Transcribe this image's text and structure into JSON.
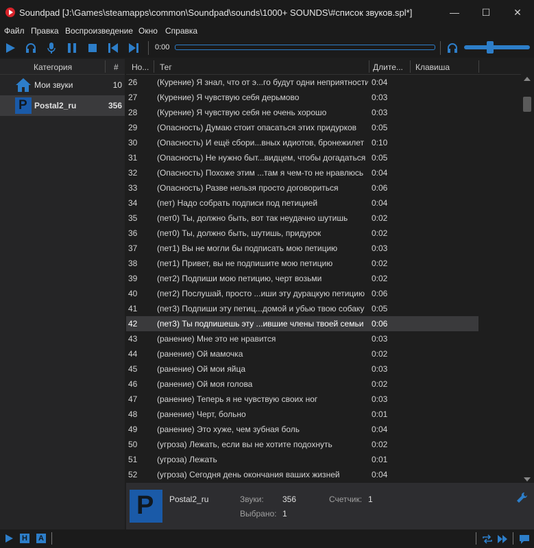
{
  "window": {
    "title": "Soundpad [J:\\Games\\steamapps\\common\\Soundpad\\sounds\\1000+ SOUNDS\\#список звуков.spl*]",
    "minimize": "—",
    "maximize": "☐",
    "close": "✕"
  },
  "menu": [
    "Файл",
    "Правка",
    "Воспроизведение",
    "Окно",
    "Справка"
  ],
  "toolbar": {
    "time": "0:00",
    "progress": 0,
    "volume": 0.4,
    "accent": "#2d7ec9"
  },
  "categories": {
    "header_name": "Категория",
    "header_count": "#",
    "items": [
      {
        "name": "Мои звуки",
        "count": "10",
        "icon": "home-icon"
      },
      {
        "name": "Postal2_ru",
        "count": "356",
        "icon": "postal-logo-icon",
        "selected": true
      }
    ]
  },
  "list": {
    "headers": {
      "num": "Но...",
      "tag": "Тег",
      "duration": "Длите...",
      "hotkey": "Клавиша"
    },
    "rows": [
      {
        "num": "26",
        "tag": "(Курение) Я знал, что от э...го будут одни неприятности",
        "dur": "0:04"
      },
      {
        "num": "27",
        "tag": "(Курение) Я чувствую себя дерьмово",
        "dur": "0:03"
      },
      {
        "num": "28",
        "tag": "(Курение) Я чувствую себя не очень хорошо",
        "dur": "0:03"
      },
      {
        "num": "29",
        "tag": "(Опасность) Думаю стоит опасаться этих придурков",
        "dur": "0:05"
      },
      {
        "num": "30",
        "tag": "(Опасность) И ещё сбори...вных идиотов, бронежилет",
        "dur": "0:10"
      },
      {
        "num": "31",
        "tag": "(Опасность) Не нужно быт...видцем, чтобы догадаться",
        "dur": "0:05"
      },
      {
        "num": "32",
        "tag": "(Опасность) Похоже этим ...там я чем-то не нравлюсь",
        "dur": "0:04"
      },
      {
        "num": "33",
        "tag": "(Опасность) Разве нельзя просто договориться",
        "dur": "0:06"
      },
      {
        "num": "34",
        "tag": "(пет) Надо собрать подписи под петицией",
        "dur": "0:04"
      },
      {
        "num": "35",
        "tag": "(пет0) Ты, должно быть, вот так неудачно шутишь",
        "dur": "0:02"
      },
      {
        "num": "36",
        "tag": "(пет0) Ты, должно быть, шутишь, придурок",
        "dur": "0:02"
      },
      {
        "num": "37",
        "tag": "(пет1) Вы не могли бы подписать мою петицию",
        "dur": "0:03"
      },
      {
        "num": "38",
        "tag": "(пет1) Привет, вы не подпишите мою петицию",
        "dur": "0:02"
      },
      {
        "num": "39",
        "tag": "(пет2) Подпиши мою петицию, черт возьми",
        "dur": "0:02"
      },
      {
        "num": "40",
        "tag": "(пет2) Послушай, просто ...иши эту дурацкую петицию",
        "dur": "0:06"
      },
      {
        "num": "41",
        "tag": "(пет3) Подпиши эту петиц...домой и убью твою собаку",
        "dur": "0:05"
      },
      {
        "num": "42",
        "tag": "(пет3) Ты подпишешь эту ...ившие члены твоей семьи",
        "dur": "0:06",
        "selected": true
      },
      {
        "num": "43",
        "tag": "(ранение) Мне это не нравится",
        "dur": "0:03"
      },
      {
        "num": "44",
        "tag": "(ранение) Ой мамочка",
        "dur": "0:02"
      },
      {
        "num": "45",
        "tag": "(ранение) Ой мои яйца",
        "dur": "0:03"
      },
      {
        "num": "46",
        "tag": "(ранение) Ой моя голова",
        "dur": "0:02"
      },
      {
        "num": "47",
        "tag": "(ранение) Теперь я не чувствую своих ног",
        "dur": "0:03"
      },
      {
        "num": "48",
        "tag": "(ранение) Черт, больно",
        "dur": "0:01"
      },
      {
        "num": "49",
        "tag": "(ранение) Это хуже, чем зубная боль",
        "dur": "0:04"
      },
      {
        "num": "50",
        "tag": "(угроза) Лежать, если вы не хотите подохнуть",
        "dur": "0:02"
      },
      {
        "num": "51",
        "tag": "(угроза) Лежать",
        "dur": "0:01"
      },
      {
        "num": "52",
        "tag": "(угроза) Сегодня день окончания ваших жизней",
        "dur": "0:04"
      }
    ]
  },
  "info": {
    "logo_letter": "P",
    "name": "Postal2_ru",
    "sounds_label": "Звуки:",
    "sounds_value": "356",
    "counter_label": "Счетчик:",
    "counter_value": "1",
    "selected_label": "Выбрано:",
    "selected_value": "1"
  },
  "statusbar": {
    "h_label": "H",
    "a_label": "A"
  }
}
